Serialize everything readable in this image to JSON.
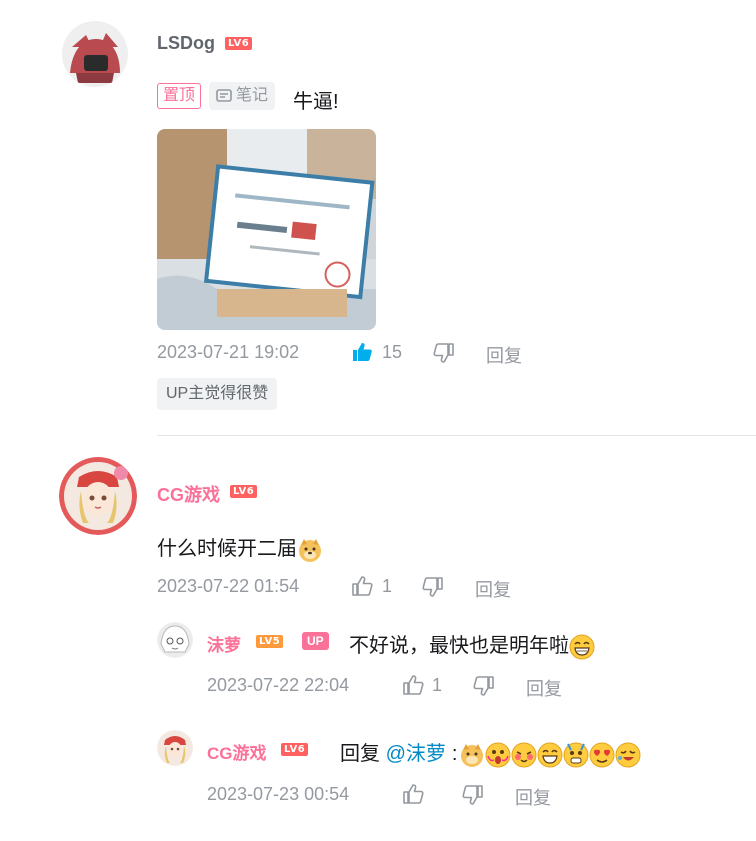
{
  "comments": [
    {
      "user": "LSDog",
      "level": "LV6",
      "pinned_tag": "置顶",
      "note_tag": "笔记",
      "text": "牛逼!",
      "time": "2023-07-21 19:02",
      "likes": "15",
      "reply_label": "回复",
      "up_tag": "UP主觉得很赞"
    },
    {
      "user": "CG游戏",
      "level": "LV6",
      "text": "什么时候开二届",
      "time": "2023-07-22 01:54",
      "likes": "1",
      "reply_label": "回复",
      "replies": [
        {
          "user": "沫萝",
          "level": "LV5",
          "up_badge": "UP",
          "text": "不好说，最快也是明年啦",
          "time": "2023-07-22 22:04",
          "likes": "1",
          "reply_label": "回复"
        },
        {
          "user": "CG游戏",
          "level": "LV6",
          "reply_prefix": "回复",
          "mention": "@沫萝",
          "colon": ":",
          "time": "2023-07-23 00:54",
          "reply_label": "回复"
        }
      ]
    }
  ],
  "colors": {
    "pink": "#fb7299",
    "blue": "#00aeec",
    "gray": "#9499a0",
    "level6": "#ff6060",
    "level5": "#ff9a3c",
    "link": "#008ac5"
  }
}
